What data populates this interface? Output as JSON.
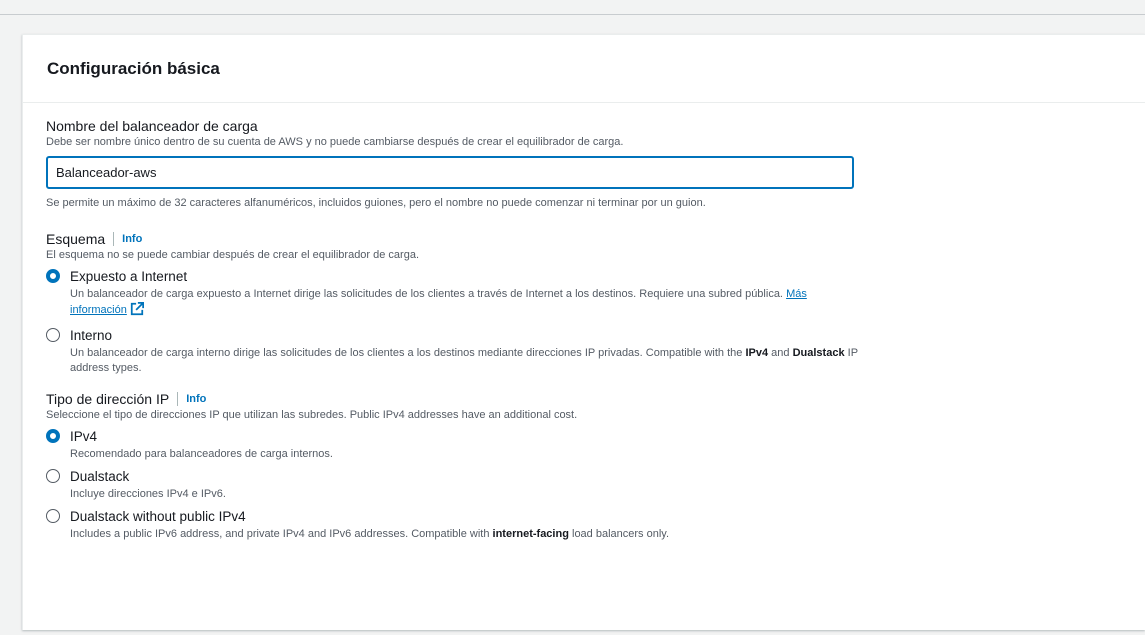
{
  "panel": {
    "title": "Configuración básica"
  },
  "name_field": {
    "label": "Nombre del balanceador de carga",
    "description": "Debe ser nombre único dentro de su cuenta de AWS y no puede cambiarse después de crear el equilibrador de carga.",
    "value": "Balanceador-aws",
    "constraint": "Se permite un máximo de 32 caracteres alfanuméricos, incluidos guiones, pero el nombre no puede comenzar ni terminar por un guion."
  },
  "scheme": {
    "label": "Esquema",
    "info": "Info",
    "description": "El esquema no se puede cambiar después de crear el equilibrador de carga.",
    "options": [
      {
        "label": "Expuesto a Internet",
        "selected": true,
        "description": "Un balanceador de carga expuesto a Internet dirige las solicitudes de los clientes a través de Internet a los destinos. Requiere una subred pública.",
        "link": "Más información",
        "link_icon": "external-link-icon"
      },
      {
        "label": "Interno",
        "selected": false,
        "description_prefix": "Un balanceador de carga interno dirige las solicitudes de los clientes a los destinos mediante direcciones IP privadas. Compatible with the",
        "bold_1": "IPv4",
        "middle": "and",
        "bold_2": "Dualstack",
        "description_suffix": "IP address types."
      }
    ]
  },
  "ip_type": {
    "label": "Tipo de dirección IP",
    "info": "Info",
    "description": "Seleccione el tipo de direcciones IP que utilizan las subredes. Public IPv4 addresses have an additional cost.",
    "options": [
      {
        "label": "IPv4",
        "selected": true,
        "description": "Recomendado para balanceadores de carga internos."
      },
      {
        "label": "Dualstack",
        "selected": false,
        "description": "Incluye direcciones IPv4 e IPv6."
      },
      {
        "label": "Dualstack without public IPv4",
        "selected": false,
        "description_prefix": "Includes a public IPv6 address, and private IPv4 and IPv6 addresses. Compatible with",
        "bold": "internet-facing",
        "description_suffix": "load balancers only."
      }
    ]
  },
  "colors": {
    "accent": "#0073bb",
    "text": "#16191f",
    "muted": "#545b64",
    "background": "#f2f3f3"
  }
}
